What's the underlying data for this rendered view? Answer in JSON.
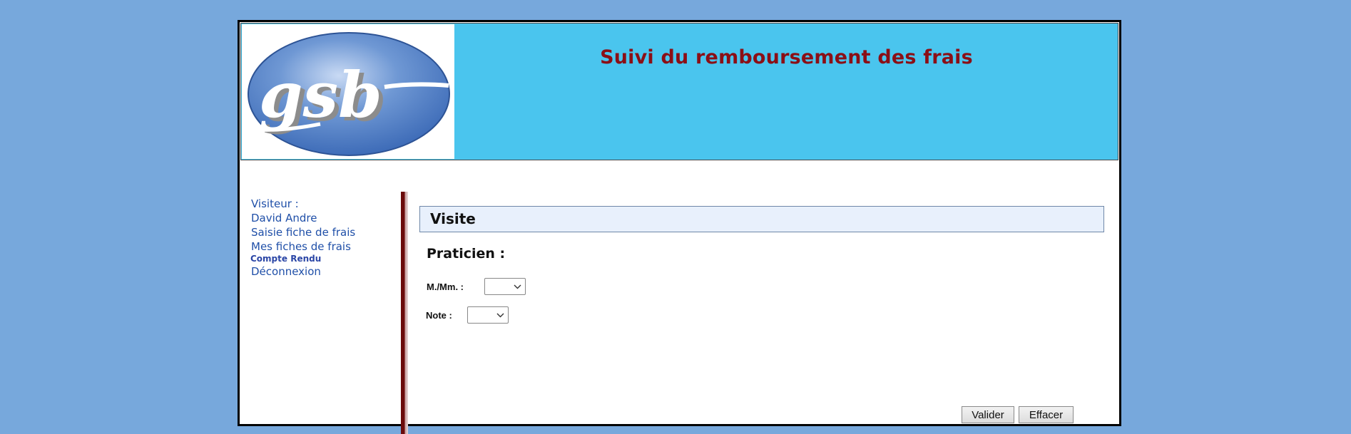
{
  "header": {
    "logo_text": "gsb",
    "title": "Suivi du remboursement des frais"
  },
  "menu": {
    "visitor_label": "Visiteur :",
    "visitor_name": "David Andre",
    "items": [
      {
        "label": "Saisie fiche de frais"
      },
      {
        "label": "Mes fiches de frais"
      },
      {
        "label": "Compte Rendu"
      },
      {
        "label": "Déconnexion"
      }
    ]
  },
  "main": {
    "section_title": "Visite",
    "subtitle": "Praticien :",
    "fields": [
      {
        "label": "M./Mm. :",
        "value": ""
      },
      {
        "label": "Note :",
        "value": ""
      }
    ],
    "buttons": {
      "submit": "Valider",
      "reset": "Effacer"
    }
  },
  "colors": {
    "page_background": "#77a8dc",
    "header_background": "#4ac5ee",
    "title": "#8b0f16",
    "menu_link": "#1f4fa8",
    "section_bar": "#e8f0fc",
    "divider": "#6b0a0a"
  }
}
